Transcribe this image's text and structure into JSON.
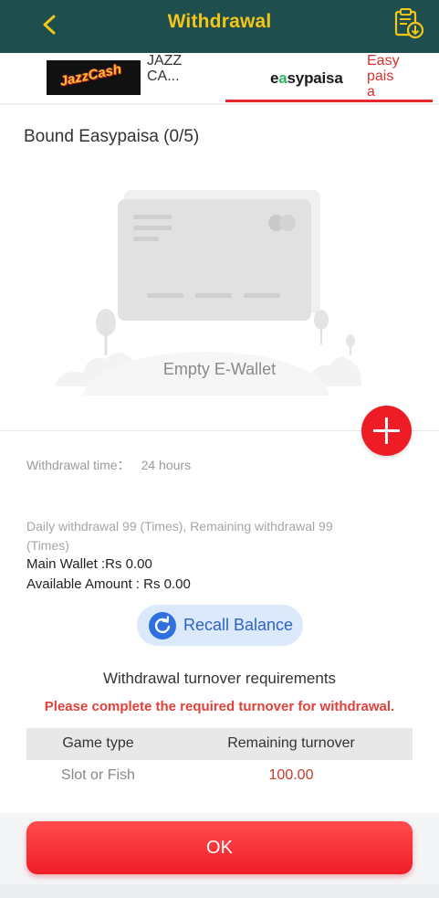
{
  "header": {
    "title": "Withdrawal",
    "back_icon": "chevron-left-icon",
    "history_icon": "clipboard-download-icon",
    "accent_color": "#f5c518",
    "bg_color": "#1e4f4e"
  },
  "tabs": [
    {
      "logo_text": "JazzCash",
      "label": "JAZZCA...",
      "selected": false
    },
    {
      "logo_text": "easypaisa",
      "label": "Easypaisa",
      "selected": true
    }
  ],
  "bound": {
    "title": "Bound Easypaisa (0/5)",
    "empty_text": "Empty E-Wallet",
    "add_icon": "plus-icon"
  },
  "info": {
    "withdrawal_time_label": "Withdrawal time：",
    "withdrawal_time_value": "24 hours",
    "daily_text": "Daily withdrawal 99 (Times), Remaining withdrawal 99 (Times)",
    "main_wallet": "Main Wallet :Rs 0.00",
    "available_amount": "Available Amount : Rs 0.00"
  },
  "recall": {
    "label": "Recall Balance",
    "icon": "refresh-icon"
  },
  "turnover": {
    "title": "Withdrawal turnover requirements",
    "warning": "Please complete the required turnover for withdrawal.",
    "columns": [
      "Game type",
      "Remaining turnover"
    ],
    "rows": [
      {
        "game_type": "Slot or Fish",
        "remaining": "100.00"
      }
    ]
  },
  "ok_label": "OK"
}
